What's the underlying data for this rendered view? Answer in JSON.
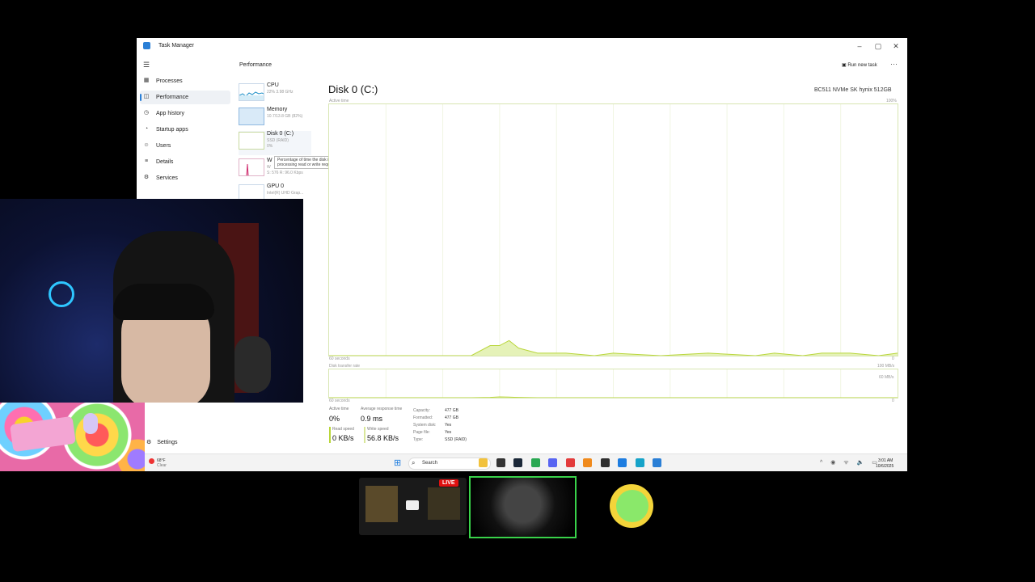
{
  "window": {
    "title": "Task Manager",
    "minimize": "–",
    "maximize": "▢",
    "close": "✕"
  },
  "sidebar": {
    "menu_icon": "☰",
    "items": [
      {
        "label": "Processes",
        "icon": "processes-icon",
        "glyph": "▦"
      },
      {
        "label": "Performance",
        "icon": "performance-icon",
        "glyph": "◫",
        "active": true
      },
      {
        "label": "App history",
        "icon": "app-history-icon",
        "glyph": "◷"
      },
      {
        "label": "Startup apps",
        "icon": "startup-apps-icon",
        "glyph": "◔"
      },
      {
        "label": "Users",
        "icon": "users-icon",
        "glyph": "☺"
      },
      {
        "label": "Details",
        "icon": "details-icon",
        "glyph": "≡"
      },
      {
        "label": "Services",
        "icon": "services-icon",
        "glyph": "⚙"
      }
    ],
    "settings_label": "Settings",
    "settings_glyph": "⚙"
  },
  "header": {
    "page_title": "Performance",
    "run_new_task": "Run new task",
    "more": "···"
  },
  "devices": [
    {
      "name": "CPU",
      "sub": "22% 3.98 GHz"
    },
    {
      "name": "Memory",
      "sub": "10.7/13.8 GB (82%)"
    },
    {
      "name": "Disk 0 (C:)",
      "sub": "SSD (RAID)",
      "sub2": "0%"
    },
    {
      "name": "W",
      "sub": "W",
      "sub2": "S: 576 R: 96.0 Kbps"
    },
    {
      "name": "GPU 0",
      "sub": "Intel(R) UHD Grap..."
    }
  ],
  "tooltip": "Percentage of time the disk is processing read or write requests",
  "main": {
    "title": "Disk 0 (C:)",
    "model": "BC511 NVMe SK hynix 512GB",
    "active_time_label": "Active time",
    "max_label": "100%",
    "seconds_label": "60 seconds",
    "zero_label": "0",
    "transfer_label": "Disk transfer rate",
    "transfer_max": "100 MB/s",
    "transfer_mid": "60 MB/s"
  },
  "chart_data": [
    {
      "type": "area",
      "title": "Active time",
      "x_label": "60 seconds",
      "ylim": [
        0,
        100
      ],
      "x": [
        0,
        5,
        10,
        15,
        17,
        18,
        19,
        20,
        21,
        22,
        23,
        25,
        28,
        30,
        35,
        40,
        45,
        47,
        50,
        52,
        55,
        58,
        60
      ],
      "values": [
        0,
        0,
        0,
        0,
        4,
        4,
        6,
        3,
        2,
        1,
        1,
        1,
        0,
        1,
        0,
        1,
        0,
        1,
        0,
        1,
        1,
        0,
        1
      ],
      "x_axis_note": "60 seconds (oldest at left)"
    },
    {
      "type": "area",
      "title": "Disk transfer rate",
      "ylim": [
        0,
        100
      ],
      "x": [
        0,
        15,
        17,
        18,
        19,
        20,
        22,
        30,
        40,
        50,
        60
      ],
      "values": [
        0,
        0,
        1,
        3,
        2,
        1,
        0,
        0,
        0,
        0,
        0
      ]
    }
  ],
  "stats": {
    "active_time_label": "Active time",
    "active_time": "0%",
    "response_label": "Average response time",
    "response": "0.9 ms",
    "read_label": "Read speed",
    "read": "0 KB/s",
    "write_label": "Write speed",
    "write": "56.8 KB/s"
  },
  "properties": [
    {
      "k": "Capacity:",
      "v": "477 GB"
    },
    {
      "k": "Formatted:",
      "v": "477 GB"
    },
    {
      "k": "System disk:",
      "v": "Yes"
    },
    {
      "k": "Page file:",
      "v": "Yes"
    },
    {
      "k": "Type:",
      "v": "SSD (RAID)"
    }
  ],
  "taskbar": {
    "weather_temp": "68°F",
    "weather_cond": "Clear",
    "start_glyph": "⊞",
    "search_label": "Search",
    "search_glyph": "⌕",
    "time": "3:01 AM",
    "date": "10/6/2025",
    "tray": "^ ◉ ᯤ 🔈 ▭",
    "apps": [
      {
        "icon": "folder-icon",
        "color": "#f2c23c"
      },
      {
        "icon": "terminal-icon",
        "color": "#333333"
      },
      {
        "icon": "steam-icon",
        "color": "#1b2838"
      },
      {
        "icon": "chrome-icon",
        "color": "#2aa852"
      },
      {
        "icon": "discord-icon",
        "color": "#5865f2"
      },
      {
        "icon": "game-icon",
        "color": "#e33b3b"
      },
      {
        "icon": "arrow-app-icon",
        "color": "#f08a1c"
      },
      {
        "icon": "obs-icon",
        "color": "#303030"
      },
      {
        "icon": "mail-icon",
        "color": "#1e7de0"
      },
      {
        "icon": "edge-icon",
        "color": "#16a3c9"
      },
      {
        "icon": "taskmanager-icon",
        "color": "#2a7fd6"
      }
    ]
  },
  "overlay": {
    "live_badge": "LIVE"
  },
  "colors": {
    "accent": "#2a7fd6",
    "graph": "#b9d63a",
    "graph_fill": "#e5f2b8"
  }
}
